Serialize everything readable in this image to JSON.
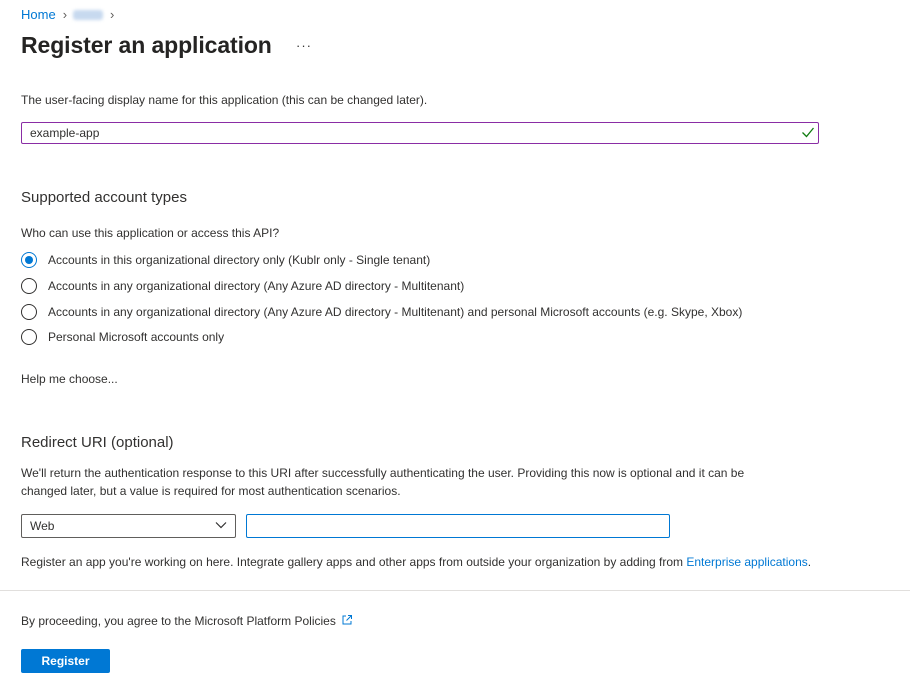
{
  "breadcrumb": {
    "home": "Home"
  },
  "page": {
    "title": "Register an application",
    "more": "···"
  },
  "name_field": {
    "label": "The user-facing display name for this application (this can be changed later).",
    "value": "example-app",
    "valid_icon": "checkmark-icon"
  },
  "account_types": {
    "heading": "Supported account types",
    "question": "Who can use this application or access this API?",
    "options": [
      {
        "label": "Accounts in this organizational directory only (Kublr only - Single tenant)",
        "selected": true
      },
      {
        "label": "Accounts in any organizational directory (Any Azure AD directory - Multitenant)",
        "selected": false
      },
      {
        "label": "Accounts in any organizational directory (Any Azure AD directory - Multitenant) and personal Microsoft accounts (e.g. Skype, Xbox)",
        "selected": false
      },
      {
        "label": "Personal Microsoft accounts only",
        "selected": false
      }
    ],
    "help_link": "Help me choose..."
  },
  "redirect": {
    "heading": "Redirect URI (optional)",
    "description_line1": "We'll return the authentication response to this URI after successfully authenticating the user. Providing this now is optional and it can be",
    "description_line2": "changed later, but a value is required for most authentication scenarios.",
    "platform_selected": "Web",
    "uri_value": ""
  },
  "info": {
    "text": "Register an app you're working on here. Integrate gallery apps and other apps from outside your organization by adding from ",
    "link": "Enterprise applications",
    "end": "."
  },
  "footer": {
    "policy_link": "By proceeding, you agree to the Microsoft Platform Policies",
    "register_label": "Register"
  },
  "colors": {
    "accent": "#0078d4",
    "focus_border": "#8a2da5",
    "valid": "#107c10"
  }
}
